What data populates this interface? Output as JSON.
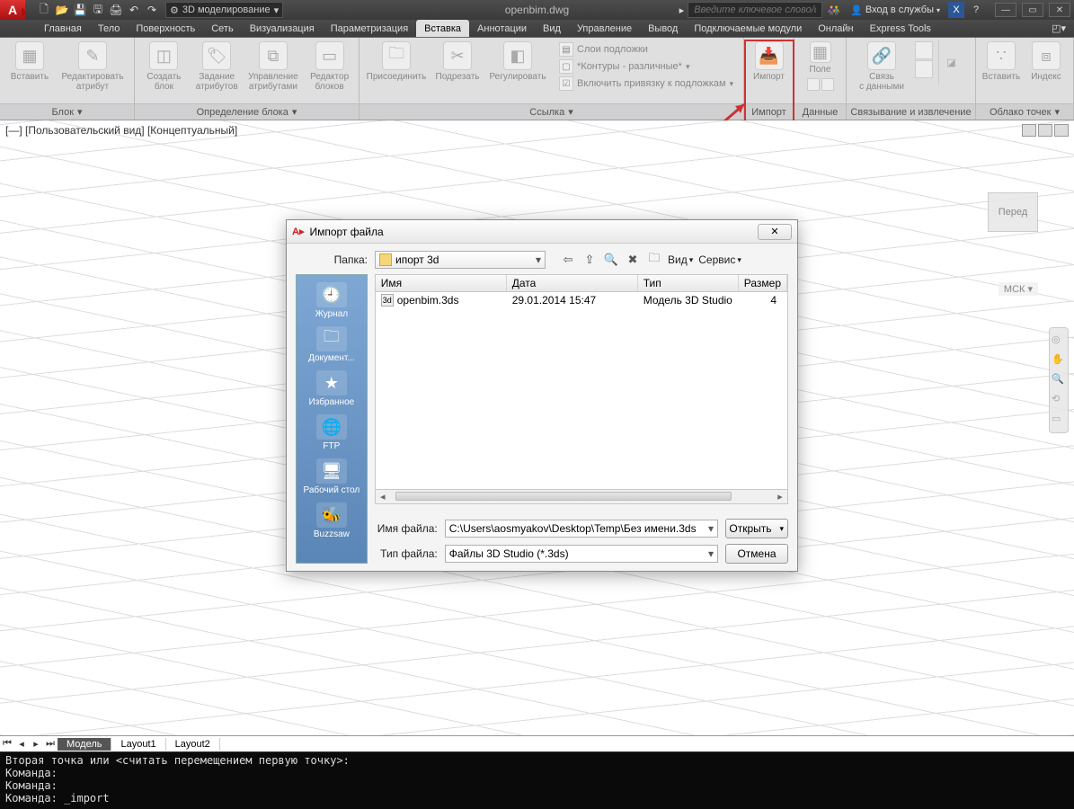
{
  "titlebar": {
    "workspace": "3D моделирование",
    "filename": "openbim.dwg",
    "search_placeholder": "Введите ключевое слово/фразу",
    "login": "Вход в службы"
  },
  "tabs": [
    "Главная",
    "Тело",
    "Поверхность",
    "Сеть",
    "Визуализация",
    "Параметризация",
    "Вставка",
    "Аннотации",
    "Вид",
    "Управление",
    "Вывод",
    "Подключаемые модули",
    "Онлайн",
    "Express Tools"
  ],
  "active_tab": "Вставка",
  "ribbon": {
    "block": {
      "insert": "Вставить",
      "edit_attr": "Редактировать\nатрибут",
      "title": "Блок"
    },
    "blockdef": {
      "create": "Создать\nблок",
      "set_attr": "Задание\nатрибутов",
      "manage": "Управление\nатрибутами",
      "blockedit": "Редактор\nблоков",
      "title": "Определение блока"
    },
    "ref": {
      "attach": "Присоединить",
      "clip": "Подрезать",
      "adjust": "Регулировать",
      "s1": "Слои подложки",
      "s2": "*Контуры - различные*",
      "s3": "Включить привязку к подложкам",
      "title": "Ссылка"
    },
    "import": {
      "btn": "Импорт",
      "title": "Импорт"
    },
    "data": {
      "field": "Поле",
      "title": "Данные"
    },
    "link": {
      "link": "Связь\nс данными",
      "title": "Связывание и извлечение"
    },
    "pcloud": {
      "insert": "Вставить",
      "index": "Индекс",
      "title": "Облако точек"
    }
  },
  "view": {
    "label": "[—] [Пользовательский вид] [Концептуальный]",
    "cube_face": "Перед",
    "wcs": "МСК"
  },
  "layout": {
    "tabs": [
      "Модель",
      "Layout1",
      "Layout2"
    ],
    "active": "Модель"
  },
  "cmd_lines": "Вторая точка или <считать перемещением первую точку>:\nКоманда:\nКоманда:\nКоманда: _import",
  "dialog": {
    "title": "Импорт файла",
    "folder_lbl": "Папка:",
    "folder": "ипорт 3d",
    "view_lbl": "Вид",
    "tools_lbl": "Сервис",
    "cols": {
      "name": "Имя",
      "date": "Дата",
      "type": "Тип",
      "size": "Размер"
    },
    "row": {
      "name": "openbim.3ds",
      "date": "29.01.2014 15:47",
      "type": "Модель 3D Studio",
      "size": "4"
    },
    "side": [
      "Журнал",
      "Документ...",
      "Избранное",
      "FTP",
      "Рабочий стол",
      "Buzzsaw"
    ],
    "fname_lbl": "Имя файла:",
    "fname": "C:\\Users\\aosmyakov\\Desktop\\Temp\\Без имени.3ds",
    "ftype_lbl": "Тип файла:",
    "ftype": "Файлы 3D Studio (*.3ds)",
    "open": "Открыть",
    "cancel": "Отмена"
  }
}
